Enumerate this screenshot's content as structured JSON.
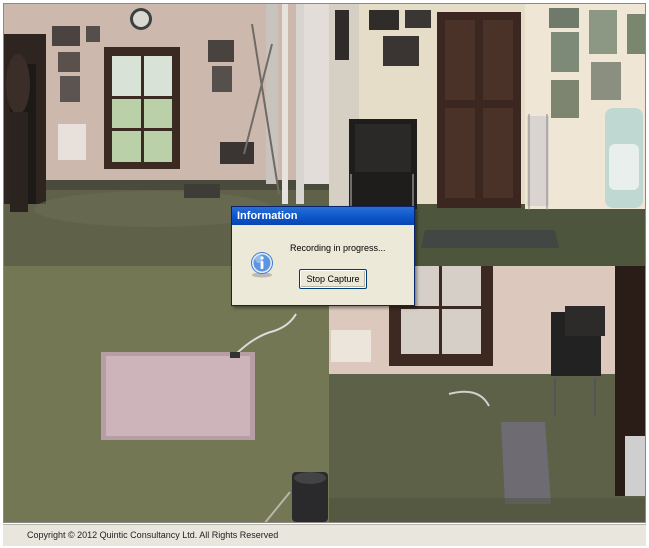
{
  "dialog": {
    "title": "Information",
    "icon": "info-icon",
    "message": "Recording in progress...",
    "button_label": "Stop Capture"
  },
  "footer": {
    "copyright": "Copyright © 2012  Quintic Consultancy Ltd.  All Rights Reserved"
  },
  "cameras": [
    {
      "name": "camera-view-1",
      "scene": "room with window, clock and door"
    },
    {
      "name": "camera-view-2",
      "scene": "room with chair, door and golf bag"
    },
    {
      "name": "camera-view-3",
      "scene": "overhead view of floor with mat"
    },
    {
      "name": "camera-view-4",
      "scene": "room with window, chair and mat"
    }
  ]
}
